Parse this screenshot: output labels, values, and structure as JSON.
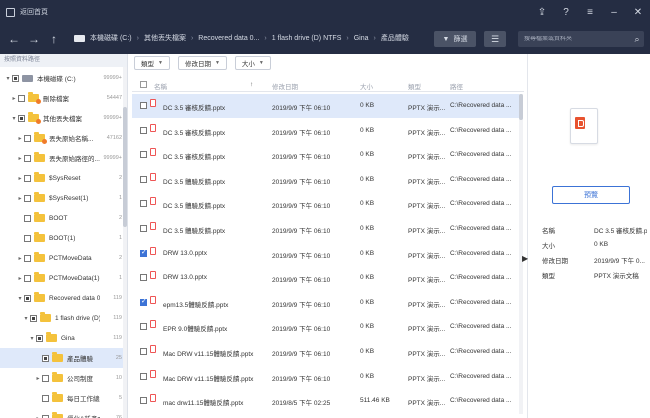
{
  "titlebar": {
    "title": "返回首頁",
    "controls": [
      "share-icon",
      "help-icon",
      "menu-icon",
      "minimize-icon",
      "close-icon"
    ]
  },
  "nav": {
    "breadcrumbs": [
      "本機磁碟 (C:)",
      "其他丟失檔案",
      "Recovered data 0...",
      "1 flash drive (D) NTFS",
      "Gina",
      "產品體驗"
    ],
    "filter_label": "篩選",
    "search_placeholder": "搜尋檔案或資料夾"
  },
  "tree": {
    "header": "按照資料路徑",
    "items": [
      {
        "label": "本機磁碟 (C:)",
        "count": "99999+",
        "level": 0,
        "arrow": "▾",
        "check": "partial",
        "icon": "drive",
        "selected": false
      },
      {
        "label": "刪除檔案",
        "count": "54447",
        "level": 1,
        "arrow": "▸",
        "check": "none",
        "icon": "folder-orange",
        "selected": false
      },
      {
        "label": "其他丟失檔案",
        "count": "99999+",
        "level": 1,
        "arrow": "▾",
        "check": "partial",
        "icon": "folder-orange",
        "selected": false
      },
      {
        "label": "丟失原始名稱...",
        "count": "47162",
        "level": 2,
        "arrow": "▸",
        "check": "none",
        "icon": "folder-orange",
        "selected": false
      },
      {
        "label": "丟失原始路徑的...",
        "count": "99999+",
        "level": 2,
        "arrow": "▸",
        "check": "none",
        "icon": "folder",
        "selected": false
      },
      {
        "label": "$SysReset",
        "count": "2",
        "level": 2,
        "arrow": "▸",
        "check": "none",
        "icon": "folder",
        "selected": false
      },
      {
        "label": "$SysReset(1)",
        "count": "1",
        "level": 2,
        "arrow": "▸",
        "check": "none",
        "icon": "folder",
        "selected": false
      },
      {
        "label": "BOOT",
        "count": "2",
        "level": 2,
        "arrow": "",
        "check": "none",
        "icon": "folder",
        "selected": false
      },
      {
        "label": "BOOT(1)",
        "count": "1",
        "level": 2,
        "arrow": "",
        "check": "none",
        "icon": "folder",
        "selected": false
      },
      {
        "label": "PCTMoveData",
        "count": "2",
        "level": 2,
        "arrow": "▸",
        "check": "none",
        "icon": "folder",
        "selected": false
      },
      {
        "label": "PCTMoveData(1)",
        "count": "1",
        "level": 2,
        "arrow": "▸",
        "check": "none",
        "icon": "folder",
        "selected": false
      },
      {
        "label": "Recovered data 09...",
        "count": "119",
        "level": 2,
        "arrow": "▾",
        "check": "partial",
        "icon": "folder",
        "selected": false
      },
      {
        "label": "1 flash drive (D) N...",
        "count": "119",
        "level": 3,
        "arrow": "▾",
        "check": "partial",
        "icon": "folder",
        "selected": false
      },
      {
        "label": "Gina",
        "count": "119",
        "level": 4,
        "arrow": "▾",
        "check": "partial",
        "icon": "folder",
        "selected": false
      },
      {
        "label": "產品體驗",
        "count": "25",
        "level": 5,
        "arrow": "",
        "check": "partial",
        "icon": "folder",
        "selected": true
      },
      {
        "label": "公司制度",
        "count": "10",
        "level": 5,
        "arrow": "▸",
        "check": "none",
        "icon": "folder",
        "selected": false
      },
      {
        "label": "每日工作總結",
        "count": "5",
        "level": 5,
        "arrow": "",
        "check": "none",
        "icon": "folder",
        "selected": false
      },
      {
        "label": "優化&新產文案",
        "count": "76",
        "level": 5,
        "arrow": "▸",
        "check": "none",
        "icon": "folder",
        "selected": false
      }
    ]
  },
  "filters": [
    {
      "label": "類型"
    },
    {
      "label": "修改日期"
    },
    {
      "label": "大小"
    }
  ],
  "table": {
    "headers": {
      "name": "名稱",
      "date": "修改日期",
      "size": "大小",
      "type": "類型",
      "path": "路徑"
    },
    "rows": [
      {
        "checked": false,
        "selected": true,
        "name": "DC 3.5 審核反饋.pptx",
        "date": "2019/9/9 下午 06:10",
        "size": "0 KB",
        "type": "PPTX 演示...",
        "path": "C:\\Recovered data ..."
      },
      {
        "checked": false,
        "selected": false,
        "name": "DC 3.5 審核反饋.pptx",
        "date": "2019/9/9 下午 06:10",
        "size": "0 KB",
        "type": "PPTX 演示...",
        "path": "C:\\Recovered data ..."
      },
      {
        "checked": false,
        "selected": false,
        "name": "DC 3.5 審核反饋.pptx",
        "date": "2019/9/9 下午 06:10",
        "size": "0 KB",
        "type": "PPTX 演示...",
        "path": "C:\\Recovered data ..."
      },
      {
        "checked": false,
        "selected": false,
        "name": "DC 3.5 體驗反饋.pptx",
        "date": "2019/9/9 下午 06:10",
        "size": "0 KB",
        "type": "PPTX 演示...",
        "path": "C:\\Recovered data ..."
      },
      {
        "checked": false,
        "selected": false,
        "name": "DC 3.5 體驗反饋.pptx",
        "date": "2019/9/9 下午 06:10",
        "size": "0 KB",
        "type": "PPTX 演示...",
        "path": "C:\\Recovered data ..."
      },
      {
        "checked": false,
        "selected": false,
        "name": "DC 3.5 體驗反饋.pptx",
        "date": "2019/9/9 下午 06:10",
        "size": "0 KB",
        "type": "PPTX 演示...",
        "path": "C:\\Recovered data ..."
      },
      {
        "checked": true,
        "selected": false,
        "name": "DRW 13.0.pptx",
        "date": "2019/9/9 下午 06:10",
        "size": "0 KB",
        "type": "PPTX 演示...",
        "path": "C:\\Recovered data ..."
      },
      {
        "checked": false,
        "selected": false,
        "name": "DRW 13.0.pptx",
        "date": "2019/9/9 下午 06:10",
        "size": "0 KB",
        "type": "PPTX 演示...",
        "path": "C:\\Recovered data ..."
      },
      {
        "checked": true,
        "selected": false,
        "name": "epm13.5體驗反饋.pptx",
        "date": "2019/9/9 下午 06:10",
        "size": "0 KB",
        "type": "PPTX 演示...",
        "path": "C:\\Recovered data ..."
      },
      {
        "checked": false,
        "selected": false,
        "name": "EPR 9.0體驗反饋.pptx",
        "date": "2019/9/9 下午 06:10",
        "size": "0 KB",
        "type": "PPTX 演示...",
        "path": "C:\\Recovered data ..."
      },
      {
        "checked": false,
        "selected": false,
        "name": "Mac DRW v11.15體驗反饋.pptx",
        "date": "2019/9/9 下午 06:10",
        "size": "0 KB",
        "type": "PPTX 演示...",
        "path": "C:\\Recovered data ..."
      },
      {
        "checked": false,
        "selected": false,
        "name": "Mac DRW v11.15體驗反饋.pptx",
        "date": "2019/9/9 下午 06:10",
        "size": "0 KB",
        "type": "PPTX 演示...",
        "path": "C:\\Recovered data ..."
      },
      {
        "checked": false,
        "selected": false,
        "name": "mac drw11.15體驗反饋.pptx",
        "date": "2019/8/5 下午 02:25",
        "size": "511.46 KB",
        "type": "PPTX 演示...",
        "path": "C:\\Recovered data ..."
      }
    ]
  },
  "preview": {
    "button_label": "預覽",
    "meta": [
      {
        "key": "名稱",
        "value": "DC 3.5 審核反饋.p..."
      },
      {
        "key": "大小",
        "value": "0 KB"
      },
      {
        "key": "修改日期",
        "value": "2019/9/9 下午 0..."
      },
      {
        "key": "類型",
        "value": "PPTX 演示文稿"
      }
    ]
  }
}
